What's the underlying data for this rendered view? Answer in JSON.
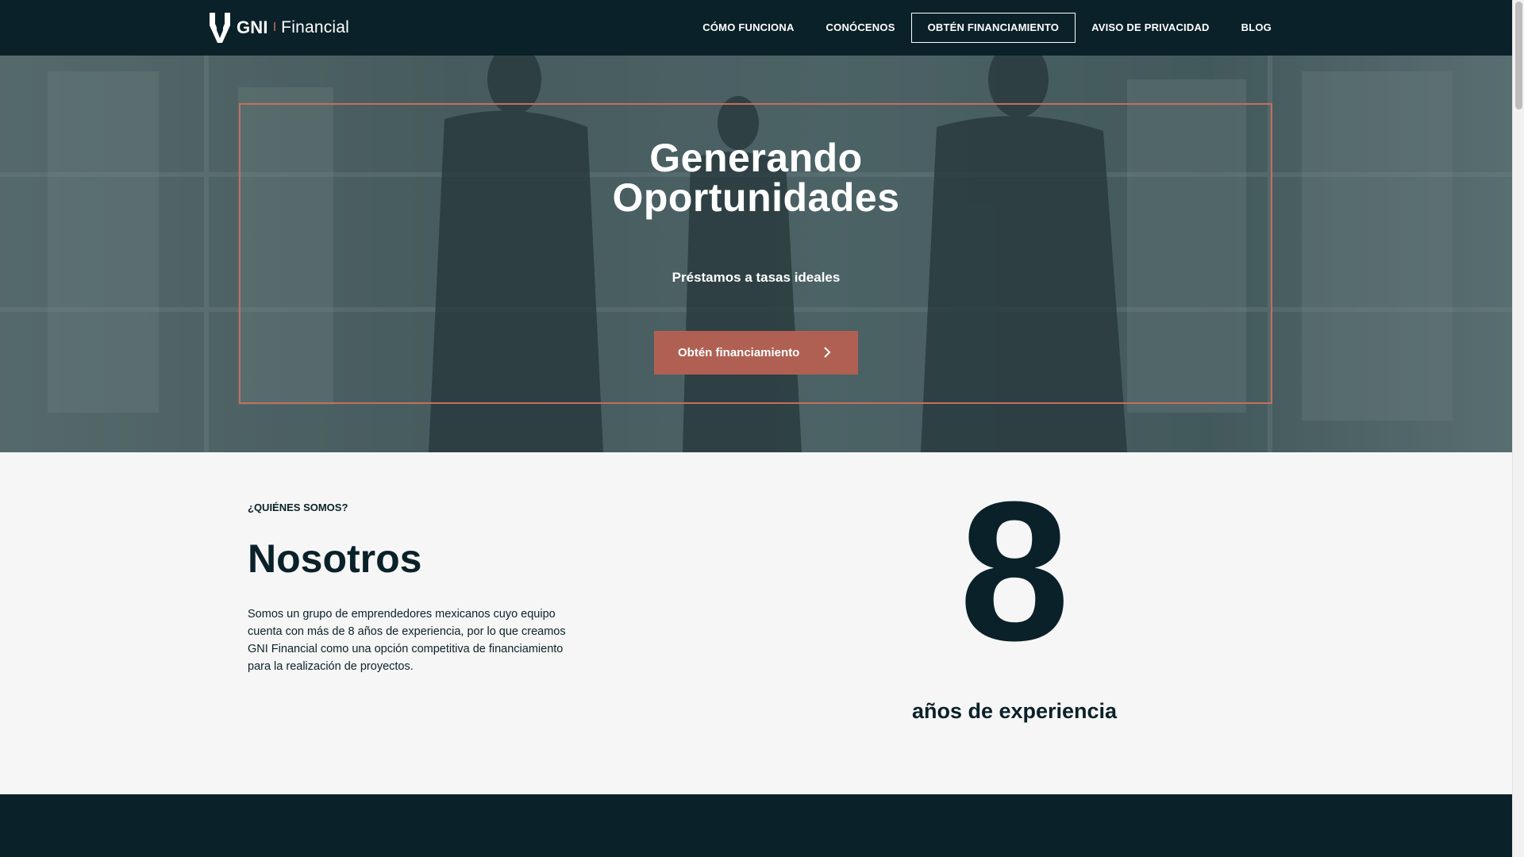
{
  "brand": {
    "name_bold": "GNI",
    "separator": "I",
    "name_light": "Financial"
  },
  "nav": {
    "items": [
      {
        "label": "CÓMO FUNCIONA"
      },
      {
        "label": "CONÓCENOS"
      },
      {
        "label": "OBTÉN FINANCIAMIENTO",
        "active": true
      },
      {
        "label": "AVISO DE PRIVACIDAD"
      },
      {
        "label": "BLOG"
      }
    ]
  },
  "hero": {
    "title_line1": "Generando",
    "title_line2": "Oportunidades",
    "subtitle": "Préstamos a tasas ideales",
    "cta_label": "Obtén financiamiento",
    "cta_icon": "chevron-right-icon"
  },
  "about": {
    "eyebrow": "¿QUIÉNES SOMOS?",
    "title": "Nosotros",
    "text": "Somos un grupo de emprendedores mexicanos cuyo equipo cuenta con más de 8 años de experiencia, por lo que creamos GNI Financial como una opción competitiva de financiamiento para la realización de proyectos.",
    "stat_value": "8",
    "stat_label": "años de experiencia"
  },
  "colors": {
    "navy": "#0b2129",
    "accent": "#c76e5c",
    "button": "#b06052",
    "background": "#f6f6f6"
  }
}
